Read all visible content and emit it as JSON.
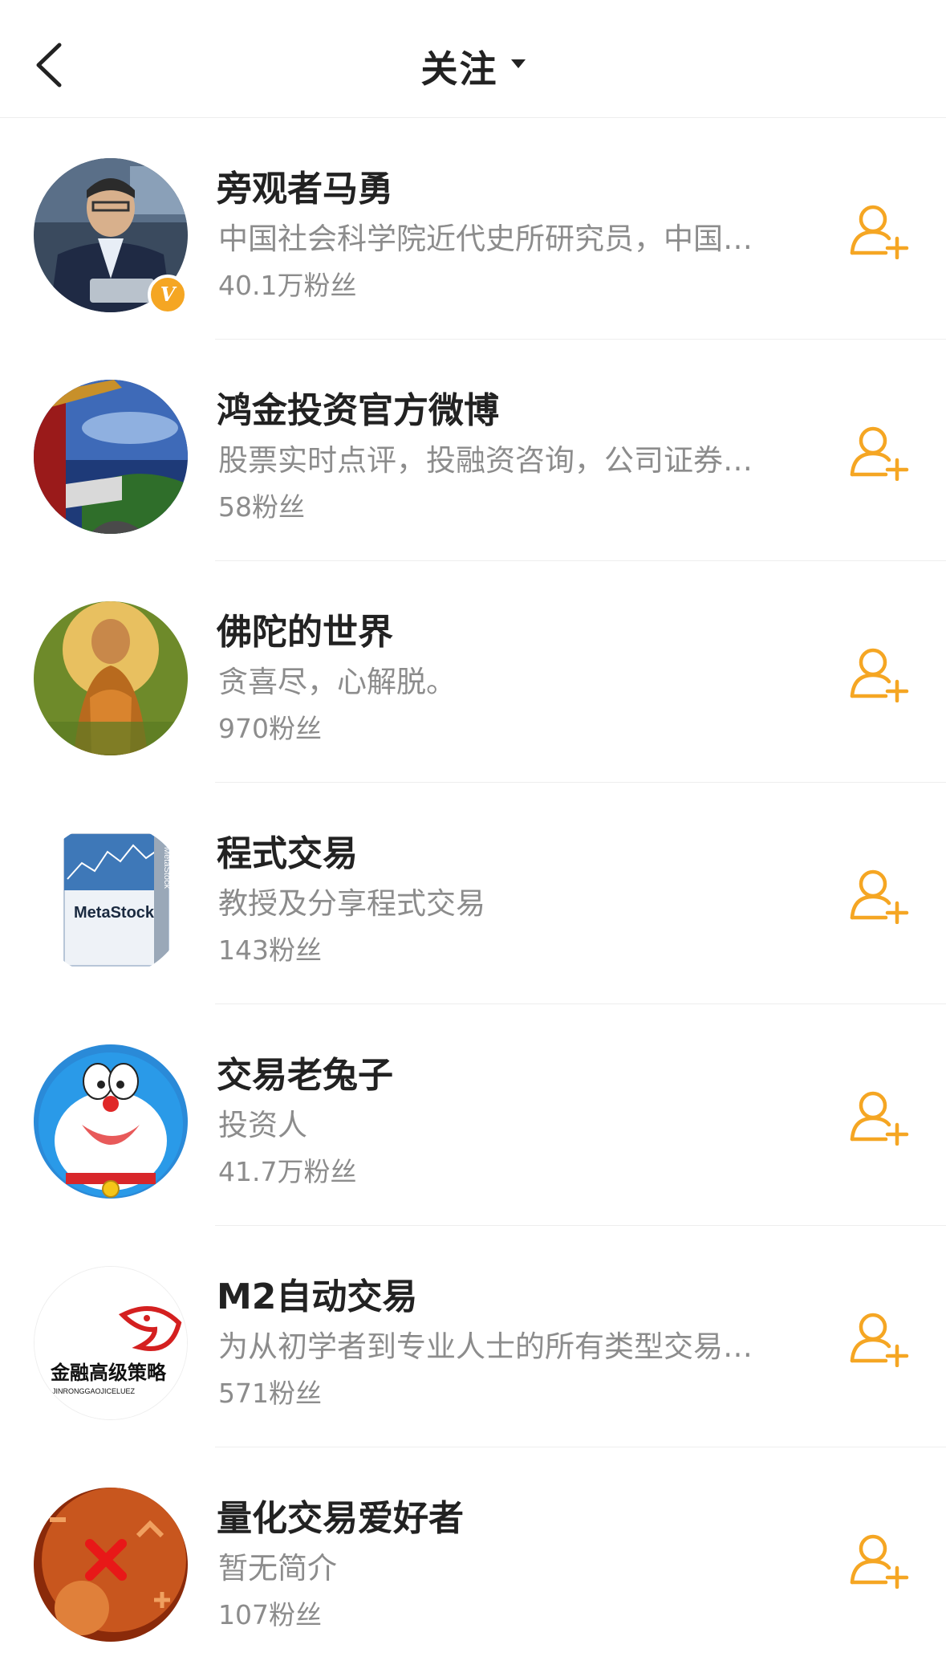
{
  "header": {
    "title": "关注",
    "back_icon": "chevron-left-icon",
    "dropdown_icon": "caret-down-icon"
  },
  "accent_color": "#f5a623",
  "users": [
    {
      "name": "旁观者马勇",
      "desc": "中国社会科学院近代史所研究员，中国…",
      "fans": "40.1万粉丝",
      "verified": true,
      "avatar": "portrait-photo"
    },
    {
      "name": "鸿金投资官方微博",
      "desc": "股票实时点评，投融资咨询，公司证券…",
      "fans": "58粉丝",
      "verified": false,
      "avatar": "palace-landscape-photo"
    },
    {
      "name": "佛陀的世界",
      "desc": "贪喜尽，心解脱。",
      "fans": "970粉丝",
      "verified": false,
      "avatar": "buddha-painting"
    },
    {
      "name": "程式交易",
      "desc": "教授及分享程式交易",
      "fans": "143粉丝",
      "verified": false,
      "avatar": "metastock-box"
    },
    {
      "name": "交易老兔子",
      "desc": "投资人",
      "fans": "41.7万粉丝",
      "verified": false,
      "avatar": "doraemon-cartoon"
    },
    {
      "name": "M2自动交易",
      "desc": "为从初学者到专业人士的所有类型交易…",
      "fans": "571粉丝",
      "verified": false,
      "avatar": "jinrong-logo"
    },
    {
      "name": "量化交易爱好者",
      "desc": "暂无简介",
      "fans": "107粉丝",
      "verified": false,
      "avatar": "math-symbols-image"
    }
  ],
  "avatar_text": {
    "metastock": "MetaStock",
    "metastock_side": "MetaStock",
    "jinrong_cn": "金融高级策略",
    "jinrong_en": "JINRONGGAOJICELUEZ"
  },
  "follow_icon": "add-user-icon",
  "verified_badge": "V"
}
